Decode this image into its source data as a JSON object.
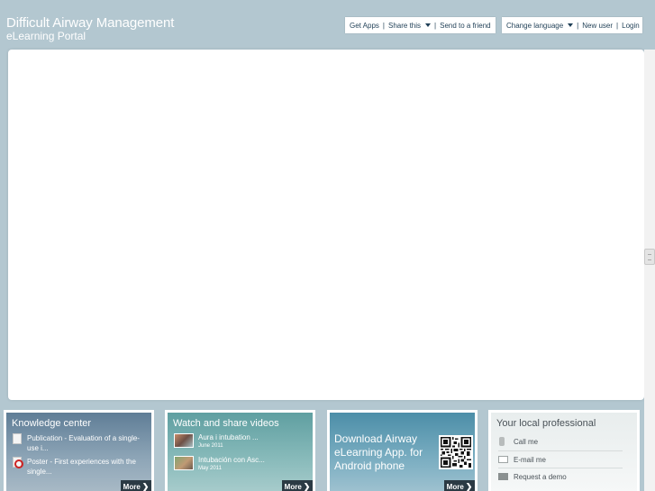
{
  "site": {
    "title": "Difficult Airway Management",
    "subtitle": "eLearning Portal"
  },
  "toolbar_left": {
    "get_apps": "Get Apps",
    "share_this": "Share this",
    "send_to_friend": "Send to a friend"
  },
  "toolbar_right": {
    "change_language": "Change language",
    "new_user": "New user",
    "login": "Login"
  },
  "separator": "|",
  "cards": {
    "knowledge": {
      "title": "Knowledge center",
      "items": [
        {
          "text": "Publication - Evaluation of a single-use i...",
          "icon": "document-icon"
        },
        {
          "text": "Poster - First experiences with the single...",
          "icon": "pdf-icon"
        }
      ],
      "more": "More"
    },
    "videos": {
      "title": "Watch and share videos",
      "items": [
        {
          "title": "Aura i intubation ...",
          "date": "June 2011"
        },
        {
          "title": "Intubación con Asc...",
          "date": "May 2011"
        }
      ],
      "more": "More"
    },
    "app": {
      "text": "Download Airway eLearning App. for Android phone",
      "more": "More",
      "icon": "qr-code-icon"
    },
    "professional": {
      "title": "Your local professional",
      "items": [
        {
          "label": "Call me",
          "icon": "phone-icon"
        },
        {
          "label": "E-mail me",
          "icon": "mail-icon"
        },
        {
          "label": "Request a demo",
          "icon": "demo-icon"
        }
      ]
    }
  },
  "colors": {
    "background": "#b3c7d0",
    "more_button": "#2b3a44",
    "toolbar_text": "#1f3f56"
  }
}
